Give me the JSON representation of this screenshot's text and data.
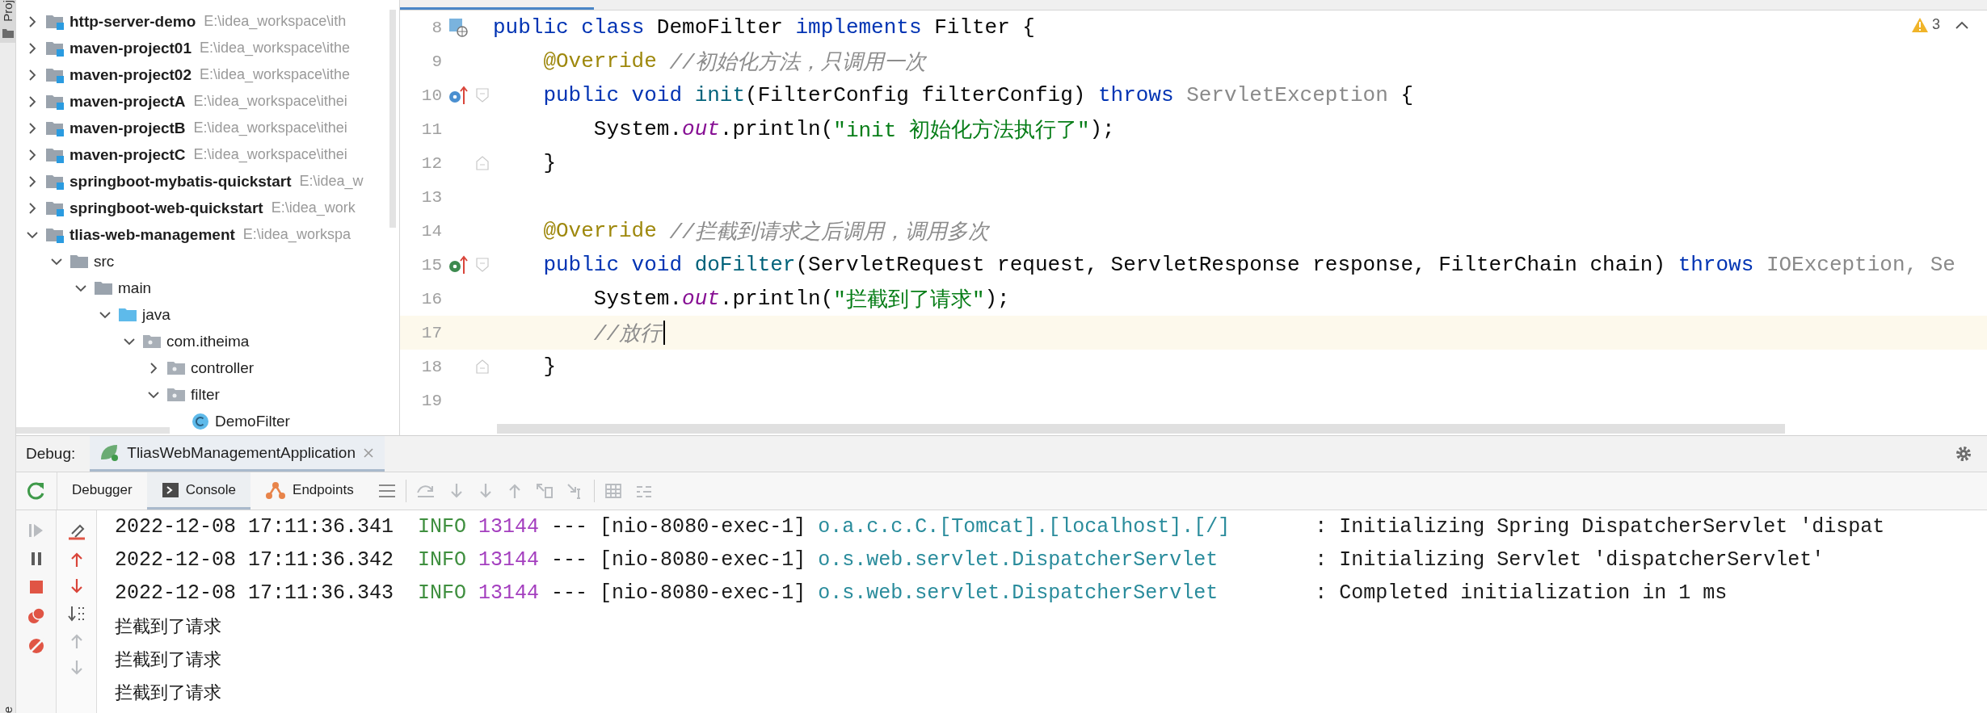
{
  "tool_strip": {
    "top_label": "Proj",
    "bottom_label": "e"
  },
  "project_tree": [
    {
      "name": "http-server-demo",
      "path": "E:\\idea_workspace\\ith",
      "kind": "module",
      "expanded": false
    },
    {
      "name": "maven-project01",
      "path": "E:\\idea_workspace\\ithe",
      "kind": "module",
      "expanded": false
    },
    {
      "name": "maven-project02",
      "path": "E:\\idea_workspace\\ithe",
      "kind": "module",
      "expanded": false
    },
    {
      "name": "maven-projectA",
      "path": "E:\\idea_workspace\\ithei",
      "kind": "module",
      "expanded": false
    },
    {
      "name": "maven-projectB",
      "path": "E:\\idea_workspace\\ithei",
      "kind": "module",
      "expanded": false
    },
    {
      "name": "maven-projectC",
      "path": "E:\\idea_workspace\\ithei",
      "kind": "module",
      "expanded": false
    },
    {
      "name": "springboot-mybatis-quickstart",
      "path": "E:\\idea_w",
      "kind": "module",
      "expanded": false
    },
    {
      "name": "springboot-web-quickstart",
      "path": "E:\\idea_work",
      "kind": "module",
      "expanded": false
    },
    {
      "name": "tlias-web-management",
      "path": "E:\\idea_workspa",
      "kind": "module",
      "expanded": true,
      "children": [
        {
          "name": "src",
          "kind": "folder",
          "expanded": true,
          "children": [
            {
              "name": "main",
              "kind": "folder",
              "expanded": true,
              "children": [
                {
                  "name": "java",
                  "kind": "source-root",
                  "expanded": true,
                  "children": [
                    {
                      "name": "com.itheima",
                      "kind": "package",
                      "expanded": true,
                      "children": [
                        {
                          "name": "controller",
                          "kind": "package",
                          "expanded": false
                        },
                        {
                          "name": "filter",
                          "kind": "package",
                          "expanded": true,
                          "children": [
                            {
                              "name": "DemoFilter",
                              "kind": "class"
                            }
                          ]
                        }
                      ]
                    }
                  ]
                }
              ]
            }
          ]
        }
      ]
    }
  ],
  "editor": {
    "warnings": "3",
    "lines": [
      {
        "number": "8",
        "current": false,
        "gutter": [
          {
            "kind": "class"
          }
        ],
        "tokens": [
          {
            "kind": "keyword",
            "text": "public class "
          },
          {
            "kind": "plain",
            "text": "DemoFilter "
          },
          {
            "kind": "keyword",
            "text": "implements "
          },
          {
            "kind": "plain",
            "text": "Filter {"
          }
        ],
        "children": [
          {
            "number": "9",
            "current": false,
            "tokens": [
              {
                "kind": "annotation",
                "text": "@Override "
              },
              {
                "kind": "comment",
                "text": "//初始化方法，只调用一次"
              }
            ]
          },
          {
            "number": "10",
            "current": false,
            "gutter": [
              {
                "kind": "implements",
                "color": "#4a8fd0"
              },
              {
                "kind": "fold-open"
              }
            ],
            "tokens": [
              {
                "kind": "keyword",
                "text": "public void "
              },
              {
                "kind": "method",
                "text": "init"
              },
              {
                "kind": "plain",
                "text": "(FilterConfig filterConfig) "
              },
              {
                "kind": "keyword",
                "text": "throws "
              },
              {
                "kind": "unresolved",
                "text": "ServletException"
              },
              {
                "kind": "plain",
                "text": " {"
              }
            ],
            "children": [
              {
                "number": "11",
                "current": false,
                "tokens": [
                  {
                    "kind": "plain",
                    "text": "System."
                  },
                  {
                    "kind": "field",
                    "text": "out"
                  },
                  {
                    "kind": "plain",
                    "text": ".println("
                  },
                  {
                    "kind": "string",
                    "text": "\"init 初始化方法执行了\""
                  },
                  {
                    "kind": "plain",
                    "text": ");"
                  }
                ]
              }
            ]
          },
          {
            "number": "12",
            "current": false,
            "gutter": [
              {
                "kind": "fold-close"
              }
            ],
            "tokens": [
              {
                "kind": "plain",
                "text": "}"
              }
            ]
          },
          {
            "number": "13",
            "current": false
          },
          {
            "number": "14",
            "current": false,
            "tokens": [
              {
                "kind": "annotation",
                "text": "@Override "
              },
              {
                "kind": "comment",
                "text": "//拦截到请求之后调用，调用多次"
              }
            ]
          },
          {
            "number": "15",
            "current": false,
            "gutter": [
              {
                "kind": "implements",
                "color": "#3d8a4f"
              },
              {
                "kind": "fold-open"
              }
            ],
            "tokens": [
              {
                "kind": "keyword",
                "text": "public void "
              },
              {
                "kind": "method",
                "text": "doFilter"
              },
              {
                "kind": "plain",
                "text": "(ServletRequest request, ServletResponse response, FilterChain chain) "
              },
              {
                "kind": "keyword",
                "text": "throws "
              },
              {
                "kind": "unresolved",
                "text": "IOException, Se"
              }
            ],
            "children": [
              {
                "number": "16",
                "current": false,
                "tokens": [
                  {
                    "kind": "plain",
                    "text": "System."
                  },
                  {
                    "kind": "field",
                    "text": "out"
                  },
                  {
                    "kind": "plain",
                    "text": ".println("
                  },
                  {
                    "kind": "string",
                    "text": "\"拦截到了请求\""
                  },
                  {
                    "kind": "plain",
                    "text": ");"
                  }
                ]
              },
              {
                "number": "17",
                "current": true,
                "tokens": [
                  {
                    "kind": "comment",
                    "text": "//放行"
                  }
                ]
              }
            ]
          },
          {
            "number": "18",
            "current": false,
            "gutter": [
              {
                "kind": "fold-close"
              }
            ],
            "tokens": [
              {
                "kind": "plain",
                "text": "}"
              }
            ]
          },
          {
            "number": "19",
            "current": false
          }
        ]
      }
    ]
  },
  "debug": {
    "label": "Debug:",
    "sessions": [
      {
        "name": "TliasWebManagementApplication",
        "selected": true
      }
    ],
    "tabs": [
      {
        "label": "Debugger",
        "kind": "plain",
        "selected": false
      },
      {
        "label": "Console",
        "kind": "console",
        "selected": true
      },
      {
        "label": "Endpoints",
        "kind": "endpoints",
        "selected": false
      }
    ],
    "console": [
      {
        "kind": "log",
        "timestamp": "2022-12-08 17:11:36.341",
        "level": "INFO",
        "pid": "13144",
        "separator": "---",
        "thread": "[nio-8080-exec-1]",
        "logger": "o.a.c.c.C.[Tomcat].[localhost].[/]",
        "message": ": Initializing Spring DispatcherServlet 'dispat"
      },
      {
        "kind": "log",
        "timestamp": "2022-12-08 17:11:36.342",
        "level": "INFO",
        "pid": "13144",
        "separator": "---",
        "thread": "[nio-8080-exec-1]",
        "logger": "o.s.web.servlet.DispatcherServlet",
        "message": ": Initializing Servlet 'dispatcherServlet'"
      },
      {
        "kind": "log",
        "timestamp": "2022-12-08 17:11:36.343",
        "level": "INFO",
        "pid": "13144",
        "separator": "---",
        "thread": "[nio-8080-exec-1]",
        "logger": "o.s.web.servlet.DispatcherServlet",
        "message": ": Completed initialization in 1 ms"
      },
      {
        "kind": "text",
        "text": "拦截到了请求"
      },
      {
        "kind": "text",
        "text": "拦截到了请求"
      },
      {
        "kind": "text",
        "text": "拦截到了请求"
      }
    ]
  }
}
